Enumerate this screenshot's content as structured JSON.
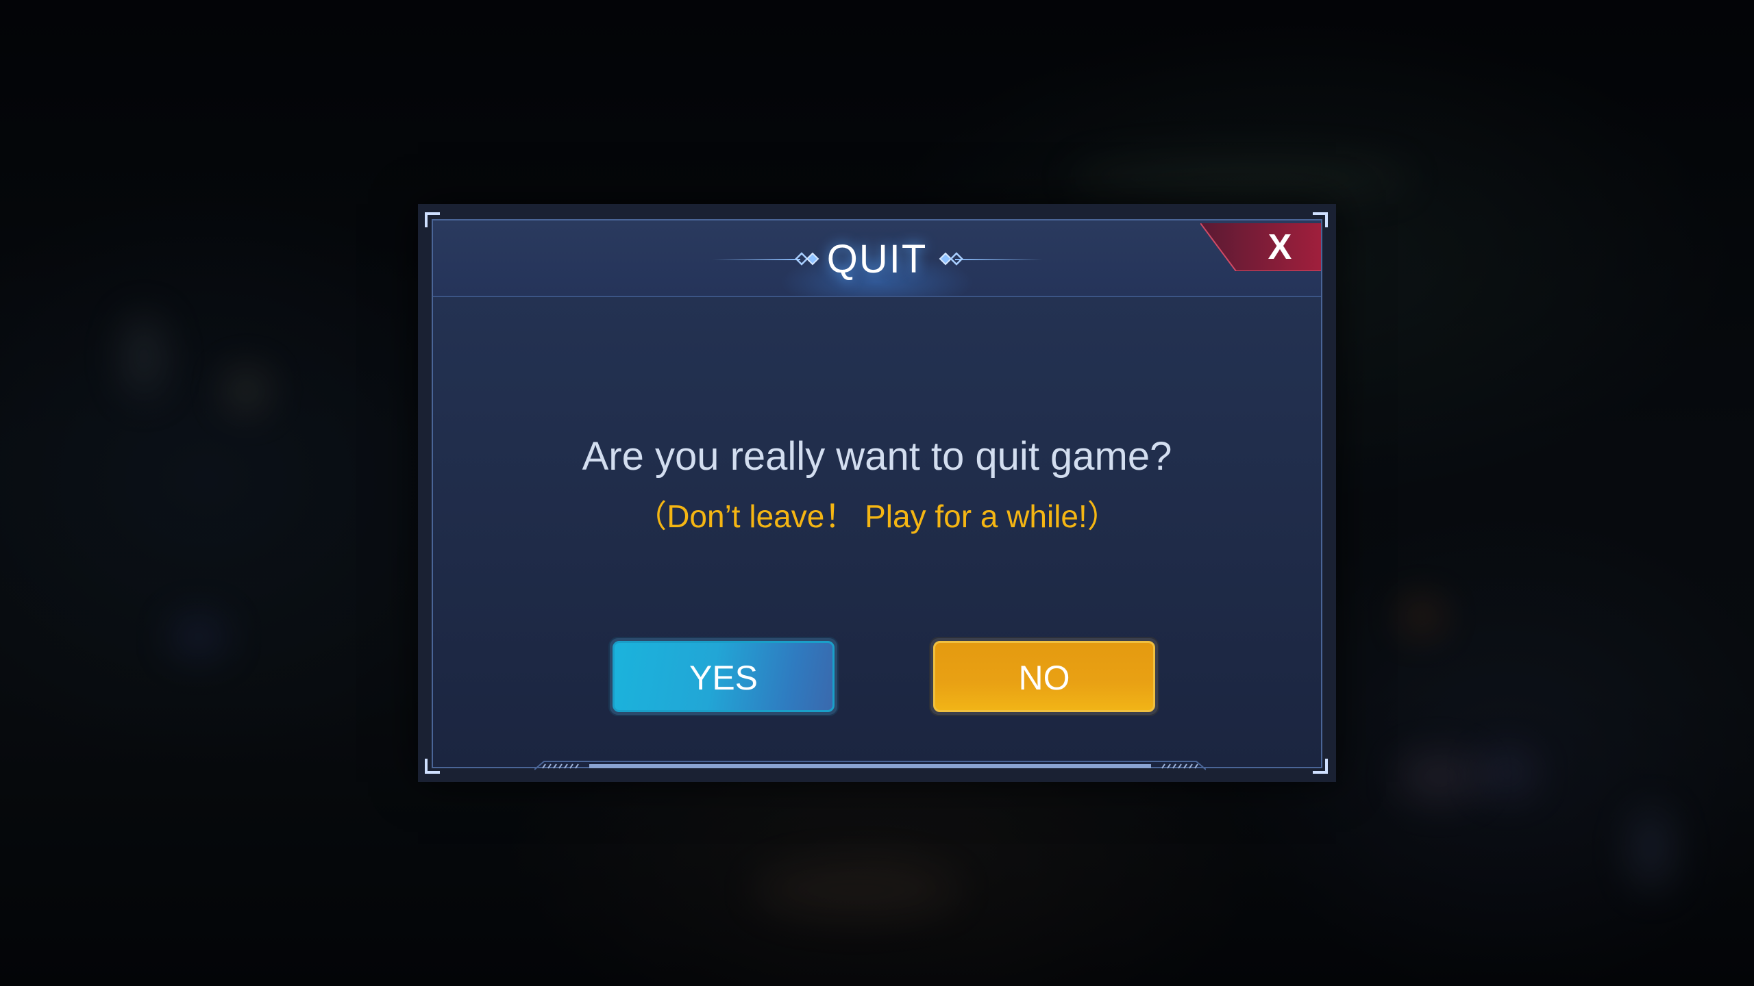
{
  "dialog": {
    "title": "QUIT",
    "close_label": "X",
    "message": "Are you really want to quit game?",
    "submessage": "（Don’t leave！ Play for a while!）",
    "yes_label": "YES",
    "no_label": "NO"
  },
  "colors": {
    "title_glow": "#5aaaff",
    "submessage": "#f5b613",
    "yes_button": "#1bb3dc",
    "no_button": "#e9a114",
    "close_button": "#8e1d39"
  },
  "icons": {
    "close": "close-icon",
    "title_ornament": "diamond-ornament-icon"
  }
}
